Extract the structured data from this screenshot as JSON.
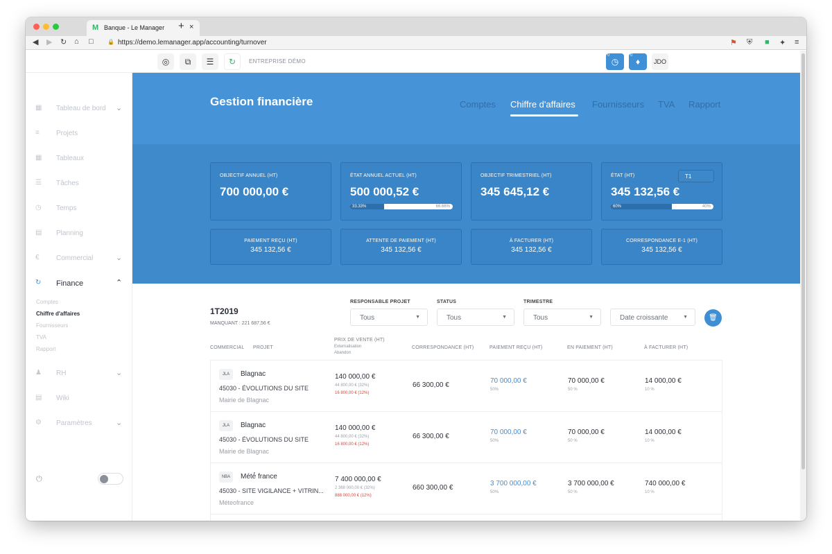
{
  "browser": {
    "tab_title": "Banque - Le Manager",
    "tab_logo": "M",
    "close": "×",
    "new_tab": "+",
    "url": "https://demo.lemanager.app/accounting/turnover"
  },
  "topbar": {
    "company": "ENTREPRISE DÉMO",
    "clock_badge": "0",
    "bell_badge": "0",
    "user_initials": "JDO"
  },
  "sidebar": {
    "items": [
      {
        "label": "Tableau de bord",
        "icon": "dashboard-icon"
      },
      {
        "label": "Projets",
        "icon": "list-icon"
      },
      {
        "label": "Tableaux",
        "icon": "grid-icon"
      },
      {
        "label": "Tâches",
        "icon": "tasks-icon"
      },
      {
        "label": "Temps",
        "icon": "clock-icon"
      },
      {
        "label": "Planning",
        "icon": "calendar-icon"
      },
      {
        "label": "Commercial",
        "icon": "euro-icon"
      },
      {
        "label": "Finance",
        "icon": "refresh-icon"
      },
      {
        "label": "RH",
        "icon": "user-icon"
      },
      {
        "label": "Wiki",
        "icon": "chat-icon"
      },
      {
        "label": "Paramètres",
        "icon": "gear-icon"
      }
    ],
    "finance_sub": [
      "Comptes",
      "Chiffre d'affaires",
      "Fournisseurs",
      "TVA",
      "Rapport"
    ]
  },
  "header": {
    "title": "Gestion financière",
    "tabs": [
      "Comptes",
      "Chiffre d'affaires",
      "Fournisseurs",
      "TVA",
      "Rapport"
    ],
    "active_tab": "Chiffre d'affaires"
  },
  "stats": {
    "objectif_annuel": {
      "label": "OBJECTIF ANNUEL (HT)",
      "value": "700 000,00 €"
    },
    "etat_annuel": {
      "label": "ÉTAT ANNUEL ACTUEL (HT)",
      "value": "500 000,52 €",
      "progress": 0.3333,
      "left": "33.33%",
      "right": "66.66%"
    },
    "objectif_trimestriel": {
      "label": "OBJECTIF TRIMESTRIEL (HT)",
      "value": "345 645,12 €"
    },
    "etat": {
      "label": "ÉTAT (HT)",
      "value": "345 132,56 €",
      "quarter": "T1",
      "progress": 0.6,
      "left": "60%",
      "right": "40%"
    },
    "paiement_recu": {
      "label": "PAIEMENT REÇU (HT)",
      "value": "345 132,56 €"
    },
    "attente_paiement": {
      "label": "ATTENTE DE PAIEMENT (HT)",
      "value": "345 132,56 €"
    },
    "a_facturer": {
      "label": "À FACTURER (HT)",
      "value": "345 132,56 €"
    },
    "correspondance": {
      "label": "CORRESPONDANCE E-1 (HT)",
      "value": "345 132,56 €"
    }
  },
  "content": {
    "period": "1T2019",
    "manquant": "MANQUANT : 221 687,56 €",
    "filters": {
      "responsable": {
        "label": "RESPONSABLE PROJET",
        "value": "Tous"
      },
      "status": {
        "label": "STATUS",
        "value": "Tous"
      },
      "trimestre": {
        "label": "TRIMESTRE",
        "value": "Tous"
      },
      "sort": {
        "value": "Date croissante"
      }
    },
    "columns": {
      "commercial": "COMMERCIAL",
      "projet": "PROJET",
      "prix": "PRIX DE VENTE (HT)",
      "prix_sub1": "Externalisation",
      "prix_sub2": "Abandon",
      "correspondance": "CORRESPONDANCE (HT)",
      "paiement_recu": "PAIEMENT REÇU (HT)",
      "en_paiement": "EN PAIEMENT (HT)",
      "a_facturer": "À FACTURER (HT)"
    },
    "rows": [
      {
        "avatar": "JLA",
        "client": "Blagnac",
        "project": "45030 - ÉVOLUTIONS DU SITE",
        "org": "Mairie de Blagnac",
        "price": "140 000,00 €",
        "ext": "44 800,00 € (32%)",
        "abandon": "16 800,00 € (12%)",
        "corr": "66 300,00 €",
        "paid": "70 000,00 €",
        "paid_pct": "50%",
        "en_paiement": "70 000,00 €",
        "en_paiement_pct": "50 %",
        "a_facturer": "14 000,00 €",
        "a_facturer_pct": "10 %"
      },
      {
        "avatar": "JLA",
        "client": "Blagnac",
        "project": "45030 - ÉVOLUTIONS DU SITE",
        "org": "Mairie de Blagnac",
        "price": "140 000,00 €",
        "ext": "44 800,00 € (32%)",
        "abandon": "16 800,00 € (12%)",
        "corr": "66 300,00 €",
        "paid": "70 000,00 €",
        "paid_pct": "50%",
        "en_paiement": "70 000,00 €",
        "en_paiement_pct": "50 %",
        "a_facturer": "14 000,00 €",
        "a_facturer_pct": "10 %"
      },
      {
        "avatar": "NBA",
        "client": "Mété́ france",
        "project": "45030 - SITE VIGILANCE + VITRIN...",
        "org": "Méteofrance",
        "price": "7 400 000,00 €",
        "ext": "2 368 000,00 € (32%)",
        "abandon": "888 000,00 € (12%)",
        "corr": "660 300,00 €",
        "paid": "3 700 000,00 €",
        "paid_pct": "50%",
        "en_paiement": "3 700 000,00 €",
        "en_paiement_pct": "50 %",
        "a_facturer": "740 000,00 €",
        "a_facturer_pct": "10 %"
      }
    ]
  }
}
